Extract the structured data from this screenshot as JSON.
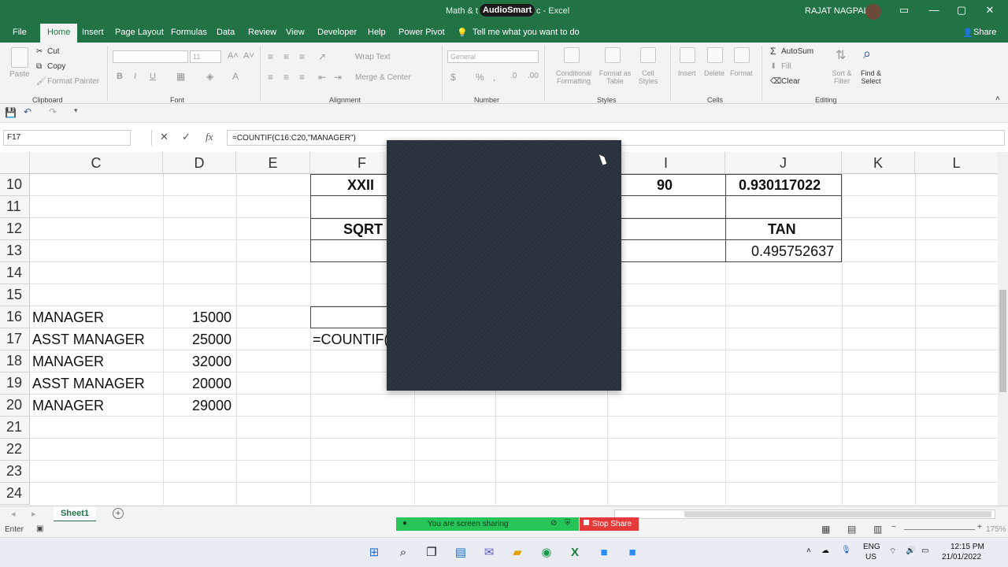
{
  "window": {
    "title_prefix": "Math & t",
    "overlay_badge": "AudioSmart",
    "title_suffix": "c - Excel",
    "user": "RAJAT NAGPAL"
  },
  "menu": [
    "File",
    "Home",
    "Insert",
    "Page Layout",
    "Formulas",
    "Data",
    "Review",
    "View",
    "Developer",
    "Help",
    "Power Pivot",
    "Tell me what you want to do"
  ],
  "share_label": "Share",
  "ribbon": {
    "clipboard": {
      "paste": "Paste",
      "cut": "Cut",
      "copy": "Copy",
      "format_painter": "Format Painter",
      "group": "Clipboard"
    },
    "font": {
      "size": "11",
      "group": "Font"
    },
    "alignment": {
      "wrap": "Wrap Text",
      "merge": "Merge & Center",
      "group": "Alignment"
    },
    "number": {
      "format": "General",
      "group": "Number"
    },
    "styles": {
      "conditional": "Conditional Formatting",
      "format_table": "Format as Table",
      "cell_styles": "Cell Styles",
      "group": "Styles"
    },
    "cells": {
      "insert": "Insert",
      "delete": "Delete",
      "format": "Format",
      "group": "Cells"
    },
    "editing": {
      "autosum": "AutoSum",
      "fill": "Fill",
      "clear": "Clear",
      "sort": "Sort & Filter",
      "find": "Find & Select",
      "group": "Editing"
    }
  },
  "formula_bar": {
    "name_box": "F17",
    "formula": "=COUNTIF(C16:C20,\"MANAGER\")"
  },
  "columns": [
    "C",
    "D",
    "E",
    "F",
    "I",
    "J",
    "K",
    "L"
  ],
  "rows": [
    "10",
    "11",
    "12",
    "13",
    "14",
    "15",
    "16",
    "17",
    "18",
    "19",
    "20",
    "21",
    "22",
    "23",
    "24"
  ],
  "cells": {
    "F10": "XXII",
    "I10": "90",
    "J10": "0.930117022",
    "F12": "SQRT",
    "J12": "TAN",
    "J13": "0.495752637",
    "C16": "MANAGER",
    "D16": "15000",
    "C17": "ASST MANAGER",
    "D17": "25000",
    "C18": "MANAGER",
    "D18": "32000",
    "C19": "ASST MANAGER",
    "D19": "20000",
    "C20": "MANAGER",
    "D20": "29000",
    "F17": "=COUNTIF("
  },
  "sheet_tab": "Sheet1",
  "status_mode": "Enter",
  "screen_share": {
    "message": "You are screen sharing",
    "stop": "Stop Share"
  },
  "zoom": "175%",
  "taskbar": {
    "lang1": "ENG",
    "lang2": "US",
    "time": "12:15 PM",
    "date": "21/01/2022"
  }
}
